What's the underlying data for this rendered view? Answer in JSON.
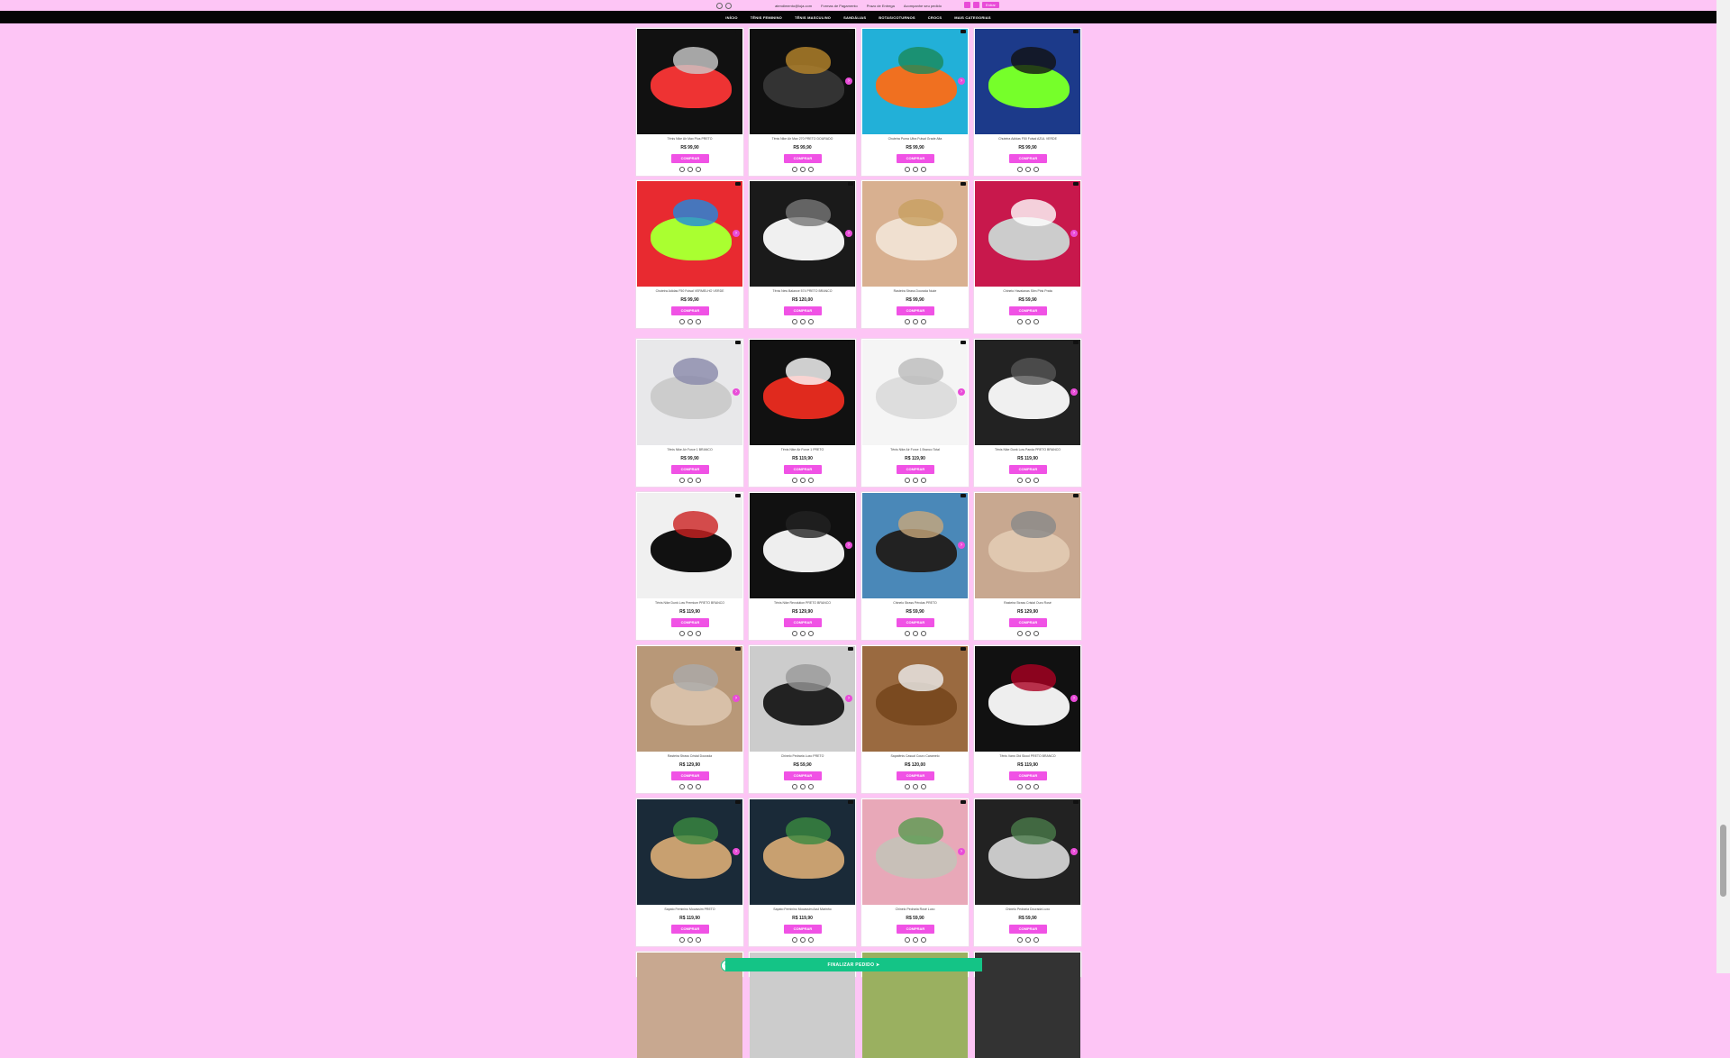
{
  "topbar": {
    "info": [
      "atendimento@loja.com",
      "Formas de Pagamento",
      "Prazo de Entrega",
      "Acompanhe seu pedido"
    ],
    "login": "Entrar"
  },
  "nav": {
    "items": [
      "INÍCIO",
      "TÊNIS FEMININO",
      "TÊNIS MASCULINO",
      "SANDÁLIAS",
      "BOTAS/COTURNOS",
      "CROCS",
      "MAIS CATEGORIAS"
    ]
  },
  "buy_label": "COMPRAR",
  "bottom_label": "FINALIZAR PEDIDO",
  "products": [
    {
      "name": "Tênis Nike Air Max Plus PRETO",
      "price": "R$ 99,90",
      "colors": [
        "#111",
        "#e33",
        "#ccc"
      ]
    },
    {
      "name": "Tênis Nike Air Max 270 PRETO DOURADO",
      "price": "R$ 99,90",
      "colors": [
        "#101010",
        "#333",
        "#b8862b"
      ]
    },
    {
      "name": "Chuteira Puma Ultra Futsal Grade Alta",
      "price": "R$ 99,90",
      "colors": [
        "#22b0d8",
        "#f07020",
        "#1a8a5a"
      ]
    },
    {
      "name": "Chuteira Adidas F50 Futsal AZUL VERDE",
      "price": "R$ 99,90",
      "colors": [
        "#1c3a8a",
        "#76ff2a",
        "#111"
      ]
    },
    {
      "name": "Chuteira Adidas F50 Futsal VERMELHO VERDE",
      "price": "R$ 99,90",
      "colors": [
        "#e82a30",
        "#aaff30",
        "#1e8ae0"
      ]
    },
    {
      "name": "Tênis New Balance 574 PRETO BRANCO",
      "price": "R$ 120,00",
      "colors": [
        "#1a1a1a",
        "#f0f0f0",
        "#777"
      ]
    },
    {
      "name": "Rasteira Strass Dourada Nude",
      "price": "R$ 99,90",
      "colors": [
        "#d8b090",
        "#f0e0d0",
        "#c8a060"
      ]
    },
    {
      "name": "Chinelo Havaianas Slim Pink Prata",
      "price": "R$ 59,90",
      "colors": [
        "#c8184c",
        "#ccc",
        "#fff"
      ]
    },
    {
      "name": "Tênis Nike Air Force 1 BRANCO",
      "price": "R$ 99,90",
      "colors": [
        "#e8e8ea",
        "#ccc",
        "#88a"
      ]
    },
    {
      "name": "Tênis Nike Air Force 1 PRETO",
      "price": "R$ 119,90",
      "colors": [
        "#111",
        "#e02a1e",
        "#fff"
      ]
    },
    {
      "name": "Tênis Nike Air Force 1 Branco Total",
      "price": "R$ 119,90",
      "colors": [
        "#f5f5f5",
        "#ddd",
        "#bbb"
      ]
    },
    {
      "name": "Tênis Nike Dunk Low Panda PRETO BRANCO",
      "price": "R$ 119,90",
      "colors": [
        "#222",
        "#f0f0f0",
        "#555"
      ]
    },
    {
      "name": "Tênis Nike Dunk Low Premium PRETO BRANCO",
      "price": "R$ 119,90",
      "colors": [
        "#f0f0f0",
        "#111",
        "#c22"
      ]
    },
    {
      "name": "Tênis Nike Revolution PRETO BRANCO",
      "price": "R$ 129,90",
      "colors": [
        "#111",
        "#eee",
        "#222"
      ]
    },
    {
      "name": "Chinelo Strass Pérolas PRETO",
      "price": "R$ 59,90",
      "colors": [
        "#4a88b8",
        "#222",
        "#c8a87a"
      ]
    },
    {
      "name": "Rasteira Strass Cristal Ouro Rosé",
      "price": "R$ 129,90",
      "colors": [
        "#c8a890",
        "#e0c8b0",
        "#888"
      ]
    },
    {
      "name": "Rasteira Strass Cristal Dourada",
      "price": "R$ 129,90",
      "colors": [
        "#b89878",
        "#d8c0a8",
        "#aaa"
      ]
    },
    {
      "name": "Chinelo Pedraria Luxo PRETO",
      "price": "R$ 59,90",
      "colors": [
        "#ccc",
        "#222",
        "#999"
      ]
    },
    {
      "name": "Sapatênis Casual Couro Caramelo",
      "price": "R$ 120,00",
      "colors": [
        "#9a6a40",
        "#7a4a20",
        "#eee"
      ]
    },
    {
      "name": "Tênis Vans Old Skool PRETO BRANCO",
      "price": "R$ 119,90",
      "colors": [
        "#111",
        "#eee",
        "#a02"
      ]
    },
    {
      "name": "Sapato Feminino Mocassim PRETO",
      "price": "R$ 119,90",
      "colors": [
        "#1a2a38",
        "#c8a070",
        "#3a8a40"
      ]
    },
    {
      "name": "Sapato Feminino Mocassim Azul Marinho",
      "price": "R$ 119,90",
      "colors": [
        "#1a2a38",
        "#c8a070",
        "#3a8a40"
      ]
    },
    {
      "name": "Chinelo Pedraria Rosê Luxo",
      "price": "R$ 59,90",
      "colors": [
        "#e8a8b8",
        "#c8c0b8",
        "#5a9a50"
      ]
    },
    {
      "name": "Chinelo Pedraria Dourada Luxo",
      "price": "R$ 59,90",
      "colors": [
        "#222",
        "#c8c8c8",
        "#4a7a4a"
      ]
    }
  ]
}
